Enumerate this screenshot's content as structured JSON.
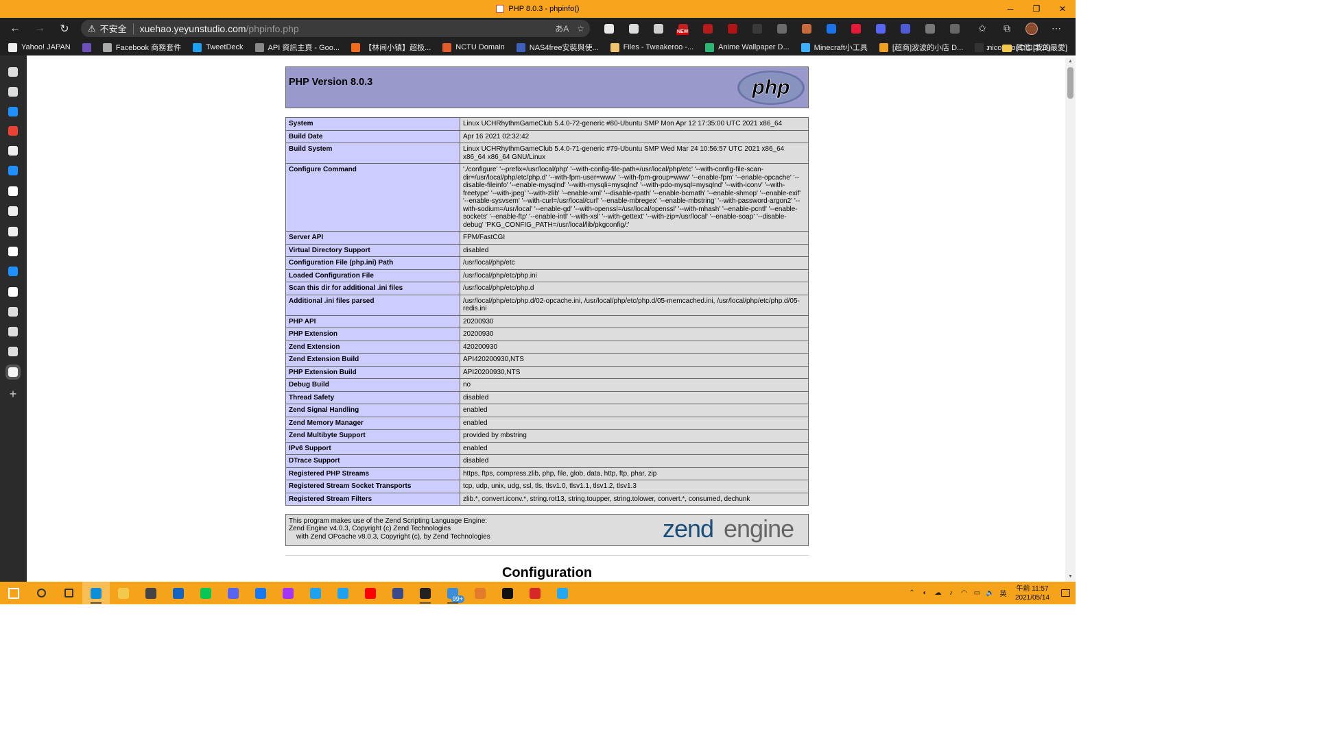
{
  "window": {
    "title": "PHP 8.0.3 - phpinfo()",
    "controls": [
      "─",
      "❐",
      "✕"
    ]
  },
  "toolbar": {
    "back": "←",
    "forward": "→",
    "reload": "↻",
    "warning_icon": "⚠",
    "security_label": "不安全",
    "url_host": "xuehao.yeyunstudio.com",
    "url_path": "/phpinfo.php",
    "translate_icon": "あA",
    "favorite_add_icon": "☆",
    "more_icon": "⋯"
  },
  "extensions": [
    {
      "name": "cloud-ext-icon",
      "color": "#e8e8e8"
    },
    {
      "name": "printer-ext-icon",
      "color": "#dcdcdc"
    },
    {
      "name": "puzzle-ext-icon",
      "color": "#cfcfcf"
    },
    {
      "name": "new-badge-ext-icon",
      "color": "#c41e1e"
    },
    {
      "name": "screen-ext-icon",
      "color": "#b71c1c"
    },
    {
      "name": "ublock-ext-icon",
      "color": "#b01515"
    },
    {
      "name": "reader-ext-icon",
      "color": "#3a3a3a"
    },
    {
      "name": "bag-ext-icon",
      "color": "#6b6b6b"
    },
    {
      "name": "palette-ext-icon",
      "color": "#c86b3c"
    },
    {
      "name": "translate-ext-icon",
      "color": "#1a73e8"
    },
    {
      "name": "yahoo-ext-icon",
      "color": "#e51937"
    },
    {
      "name": "discord-ext-icon",
      "color": "#5865f2"
    },
    {
      "name": "discord2-ext-icon",
      "color": "#4f5bd5"
    },
    {
      "name": "chat-ext-icon",
      "color": "#777777"
    },
    {
      "name": "filter-ext-icon",
      "color": "#666666"
    }
  ],
  "new_badge": "NEW",
  "bookmarks": [
    {
      "label": "Yahoo! JAPAN",
      "color": "#eeeeee"
    },
    {
      "label": "",
      "color": "#6b4fbb"
    },
    {
      "label": "Facebook 商務套件",
      "color": "#aaaaaa"
    },
    {
      "label": "TweetDeck",
      "color": "#1da1f2"
    },
    {
      "label": "API 資訊主頁 - Goo...",
      "color": "#888888"
    },
    {
      "label": "【林间小镇】超极...",
      "color": "#f26b1d"
    },
    {
      "label": "NCTU Domain",
      "color": "#e25b2b"
    },
    {
      "label": "NAS4free安裝與使...",
      "color": "#3f5fbf"
    },
    {
      "label": "Files - Tweakeroo -...",
      "color": "#f0c36d"
    },
    {
      "label": "Anime Wallpaper D...",
      "color": "#2bb673"
    },
    {
      "label": "Minecraft小工具",
      "color": "#3ab0ff"
    },
    {
      "label": "[超商]波波的小店 D...",
      "color": "#f0a020"
    },
    {
      "label": "niconico(ニコニコ)",
      "color": "#333333"
    }
  ],
  "bookmarks_more": "›",
  "other_bookmarks": "其他 [我的最愛]",
  "sidebar_icons": [
    {
      "name": "tab-actions-icon",
      "color": "#dddddd"
    },
    {
      "name": "page-icon",
      "color": "#dddddd"
    },
    {
      "name": "bing-icon",
      "color": "#1e90ff"
    },
    {
      "name": "google-icon",
      "color": "#ea4335"
    },
    {
      "name": "baseball-icon",
      "color": "#eeeeee"
    },
    {
      "name": "bing2-icon",
      "color": "#1e90ff"
    },
    {
      "name": "wikipedia-icon",
      "color": "#ffffff"
    },
    {
      "name": "notes-icon",
      "color": "#eeeeee"
    },
    {
      "name": "notes2-icon",
      "color": "#eeeeee"
    },
    {
      "name": "github-icon",
      "color": "#ffffff"
    },
    {
      "name": "bing3-icon",
      "color": "#1e90ff"
    },
    {
      "name": "wordpress-icon",
      "color": "#ffffff"
    },
    {
      "name": "doc1-icon",
      "color": "#dddddd"
    },
    {
      "name": "doc2-icon",
      "color": "#dddddd"
    },
    {
      "name": "doc3-icon",
      "color": "#dddddd"
    },
    {
      "name": "php-tab-icon",
      "color": "#f5f5f5"
    }
  ],
  "sidebar_add": "+",
  "php": {
    "title": "PHP Version 8.0.3",
    "logo_text": "php",
    "rows": [
      {
        "k": "System",
        "v": "Linux UCHRhythmGameClub 5.4.0-72-generic #80-Ubuntu SMP Mon Apr 12 17:35:00 UTC 2021 x86_64"
      },
      {
        "k": "Build Date",
        "v": "Apr 16 2021 02:32:42"
      },
      {
        "k": "Build System",
        "v": "Linux UCHRhythmGameClub 5.4.0-71-generic #79-Ubuntu SMP Wed Mar 24 10:56:57 UTC 2021 x86_64 x86_64 x86_64 GNU/Linux"
      },
      {
        "k": "Configure Command",
        "v": "'./configure' '--prefix=/usr/local/php' '--with-config-file-path=/usr/local/php/etc' '--with-config-file-scan-dir=/usr/local/php/etc/php.d' '--with-fpm-user=www' '--with-fpm-group=www' '--enable-fpm' '--enable-opcache' '--disable-fileinfo' '--enable-mysqlnd' '--with-mysqli=mysqlnd' '--with-pdo-mysql=mysqlnd' '--with-iconv' '--with-freetype' '--with-jpeg' '--with-zlib' '--enable-xml' '--disable-rpath' '--enable-bcmath' '--enable-shmop' '--enable-exif' '--enable-sysvsem' '--with-curl=/usr/local/curl' '--enable-mbregex' '--enable-mbstring' '--with-password-argon2' '--with-sodium=/usr/local' '--enable-gd' '--with-openssl=/usr/local/openssl' '--with-mhash' '--enable-pcntl' '--enable-sockets' '--enable-ftp' '--enable-intl' '--with-xsl' '--with-gettext' '--with-zip=/usr/local' '--enable-soap' '--disable-debug' 'PKG_CONFIG_PATH=/usr/local/lib/pkgconfig/:'"
      },
      {
        "k": "Server API",
        "v": "FPM/FastCGI"
      },
      {
        "k": "Virtual Directory Support",
        "v": "disabled"
      },
      {
        "k": "Configuration File (php.ini) Path",
        "v": "/usr/local/php/etc"
      },
      {
        "k": "Loaded Configuration File",
        "v": "/usr/local/php/etc/php.ini"
      },
      {
        "k": "Scan this dir for additional .ini files",
        "v": "/usr/local/php/etc/php.d"
      },
      {
        "k": "Additional .ini files parsed",
        "v": "/usr/local/php/etc/php.d/02-opcache.ini, /usr/local/php/etc/php.d/05-memcached.ini, /usr/local/php/etc/php.d/05-redis.ini"
      },
      {
        "k": "PHP API",
        "v": "20200930"
      },
      {
        "k": "PHP Extension",
        "v": "20200930"
      },
      {
        "k": "Zend Extension",
        "v": "420200930"
      },
      {
        "k": "Zend Extension Build",
        "v": "API420200930,NTS"
      },
      {
        "k": "PHP Extension Build",
        "v": "API20200930,NTS"
      },
      {
        "k": "Debug Build",
        "v": "no"
      },
      {
        "k": "Thread Safety",
        "v": "disabled"
      },
      {
        "k": "Zend Signal Handling",
        "v": "enabled"
      },
      {
        "k": "Zend Memory Manager",
        "v": "enabled"
      },
      {
        "k": "Zend Multibyte Support",
        "v": "provided by mbstring"
      },
      {
        "k": "IPv6 Support",
        "v": "enabled"
      },
      {
        "k": "DTrace Support",
        "v": "disabled"
      },
      {
        "k": "Registered PHP Streams",
        "v": "https, ftps, compress.zlib, php, file, glob, data, http, ftp, phar, zip"
      },
      {
        "k": "Registered Stream Socket Transports",
        "v": "tcp, udp, unix, udg, ssl, tls, tlsv1.0, tlsv1.1, tlsv1.2, tlsv1.3"
      },
      {
        "k": "Registered Stream Filters",
        "v": "zlib.*, convert.iconv.*, string.rot13, string.toupper, string.tolower, convert.*, consumed, dechunk"
      }
    ],
    "zend_line1": "This program makes use of the Zend Scripting Language Engine:",
    "zend_line2": "Zend Engine v4.0.3, Copyright (c) Zend Technologies",
    "zend_line3": "with Zend OPcache v8.0.3, Copyright (c), by Zend Technologies",
    "zend_logo_a": "zend",
    "zend_logo_b": "engine",
    "config_heading": "Configuration"
  },
  "taskbar": {
    "apps": [
      {
        "name": "start-icon",
        "color": "#ffffff"
      },
      {
        "name": "search-icon",
        "color": "#333333"
      },
      {
        "name": "task-view-icon",
        "color": "#333333"
      },
      {
        "name": "edge-icon",
        "color": "#0c8ed9"
      },
      {
        "name": "file-explorer-icon",
        "color": "#f2c94c"
      },
      {
        "name": "store-icon",
        "color": "#444444"
      },
      {
        "name": "mail-icon",
        "color": "#1565c0"
      },
      {
        "name": "line-icon",
        "color": "#06c755"
      },
      {
        "name": "discord-icon",
        "color": "#5865f2"
      },
      {
        "name": "facebook-icon",
        "color": "#1877f2"
      },
      {
        "name": "messenger-icon",
        "color": "#a334fa"
      },
      {
        "name": "twitter-icon",
        "color": "#1da1f2"
      },
      {
        "name": "twitter2-icon",
        "color": "#1da1f2"
      },
      {
        "name": "youtube-icon",
        "color": "#ff0000"
      },
      {
        "name": "remote-icon",
        "color": "#3a4a8a"
      },
      {
        "name": "terminal-icon",
        "color": "#222222"
      },
      {
        "name": "folder-sync-icon",
        "color": "#3b8dd8"
      },
      {
        "name": "bird-icon",
        "color": "#e27b2c"
      },
      {
        "name": "speedometer-icon",
        "color": "#111111"
      },
      {
        "name": "rhythm-icon",
        "color": "#d62828"
      },
      {
        "name": "vscode-icon",
        "color": "#23a9f2"
      }
    ],
    "badge": "99+",
    "tray_icons": [
      "⌃",
      "◐",
      "☁",
      "♪",
      "◠",
      "▭",
      "🔈",
      "英"
    ],
    "time": "午前 11:57",
    "date": "2021/05/14"
  }
}
